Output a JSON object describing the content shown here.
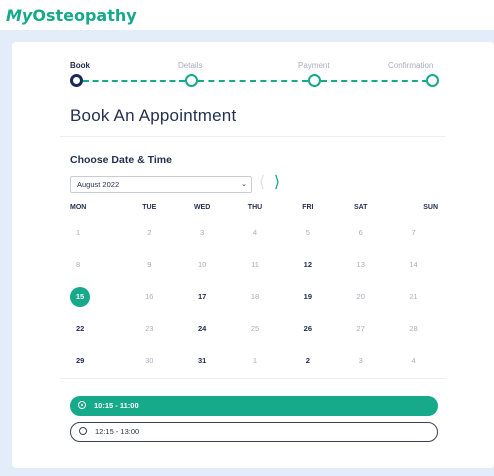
{
  "brand": {
    "prefix": "My",
    "name": "Osteopathy"
  },
  "stepper": {
    "steps": [
      {
        "label": "Book",
        "state": "active"
      },
      {
        "label": "Details",
        "state": "pending"
      },
      {
        "label": "Payment",
        "state": "pending"
      },
      {
        "label": "Confirmation",
        "state": "pending"
      }
    ]
  },
  "page_title": "Book An Appointment",
  "date_section": {
    "title": "Choose Date & Time",
    "month_select": "August 2022",
    "prev_icon": "chevron-left-icon",
    "next_icon": "chevron-right-icon"
  },
  "calendar": {
    "weekdays": [
      "MON",
      "TUE",
      "WED",
      "THU",
      "FRI",
      "SAT",
      "SUN"
    ],
    "weeks": [
      [
        {
          "d": "1",
          "s": "disabled"
        },
        {
          "d": "2",
          "s": "disabled"
        },
        {
          "d": "3",
          "s": "disabled"
        },
        {
          "d": "4",
          "s": "disabled"
        },
        {
          "d": "5",
          "s": "disabled"
        },
        {
          "d": "6",
          "s": "disabled"
        },
        {
          "d": "7",
          "s": "disabled"
        }
      ],
      [
        {
          "d": "8",
          "s": "disabled"
        },
        {
          "d": "9",
          "s": "disabled"
        },
        {
          "d": "10",
          "s": "disabled"
        },
        {
          "d": "11",
          "s": "disabled"
        },
        {
          "d": "12",
          "s": "available"
        },
        {
          "d": "13",
          "s": "disabled"
        },
        {
          "d": "14",
          "s": "disabled"
        }
      ],
      [
        {
          "d": "15",
          "s": "selected"
        },
        {
          "d": "16",
          "s": "disabled"
        },
        {
          "d": "17",
          "s": "available"
        },
        {
          "d": "18",
          "s": "disabled"
        },
        {
          "d": "19",
          "s": "available"
        },
        {
          "d": "20",
          "s": "disabled"
        },
        {
          "d": "21",
          "s": "disabled"
        }
      ],
      [
        {
          "d": "22",
          "s": "available"
        },
        {
          "d": "23",
          "s": "disabled"
        },
        {
          "d": "24",
          "s": "available"
        },
        {
          "d": "25",
          "s": "disabled"
        },
        {
          "d": "26",
          "s": "available"
        },
        {
          "d": "27",
          "s": "disabled"
        },
        {
          "d": "28",
          "s": "disabled"
        }
      ],
      [
        {
          "d": "29",
          "s": "available"
        },
        {
          "d": "30",
          "s": "disabled"
        },
        {
          "d": "31",
          "s": "available"
        },
        {
          "d": "1",
          "s": "disabled"
        },
        {
          "d": "2",
          "s": "available"
        },
        {
          "d": "3",
          "s": "disabled"
        },
        {
          "d": "4",
          "s": "disabled"
        }
      ]
    ]
  },
  "time_slots": [
    {
      "label": "10:15 - 11:00",
      "selected": true
    },
    {
      "label": "12:15 - 13:00",
      "selected": false
    }
  ],
  "colors": {
    "accent": "#16a98a",
    "navy": "#1a2b57",
    "background": "#e2edf9"
  }
}
